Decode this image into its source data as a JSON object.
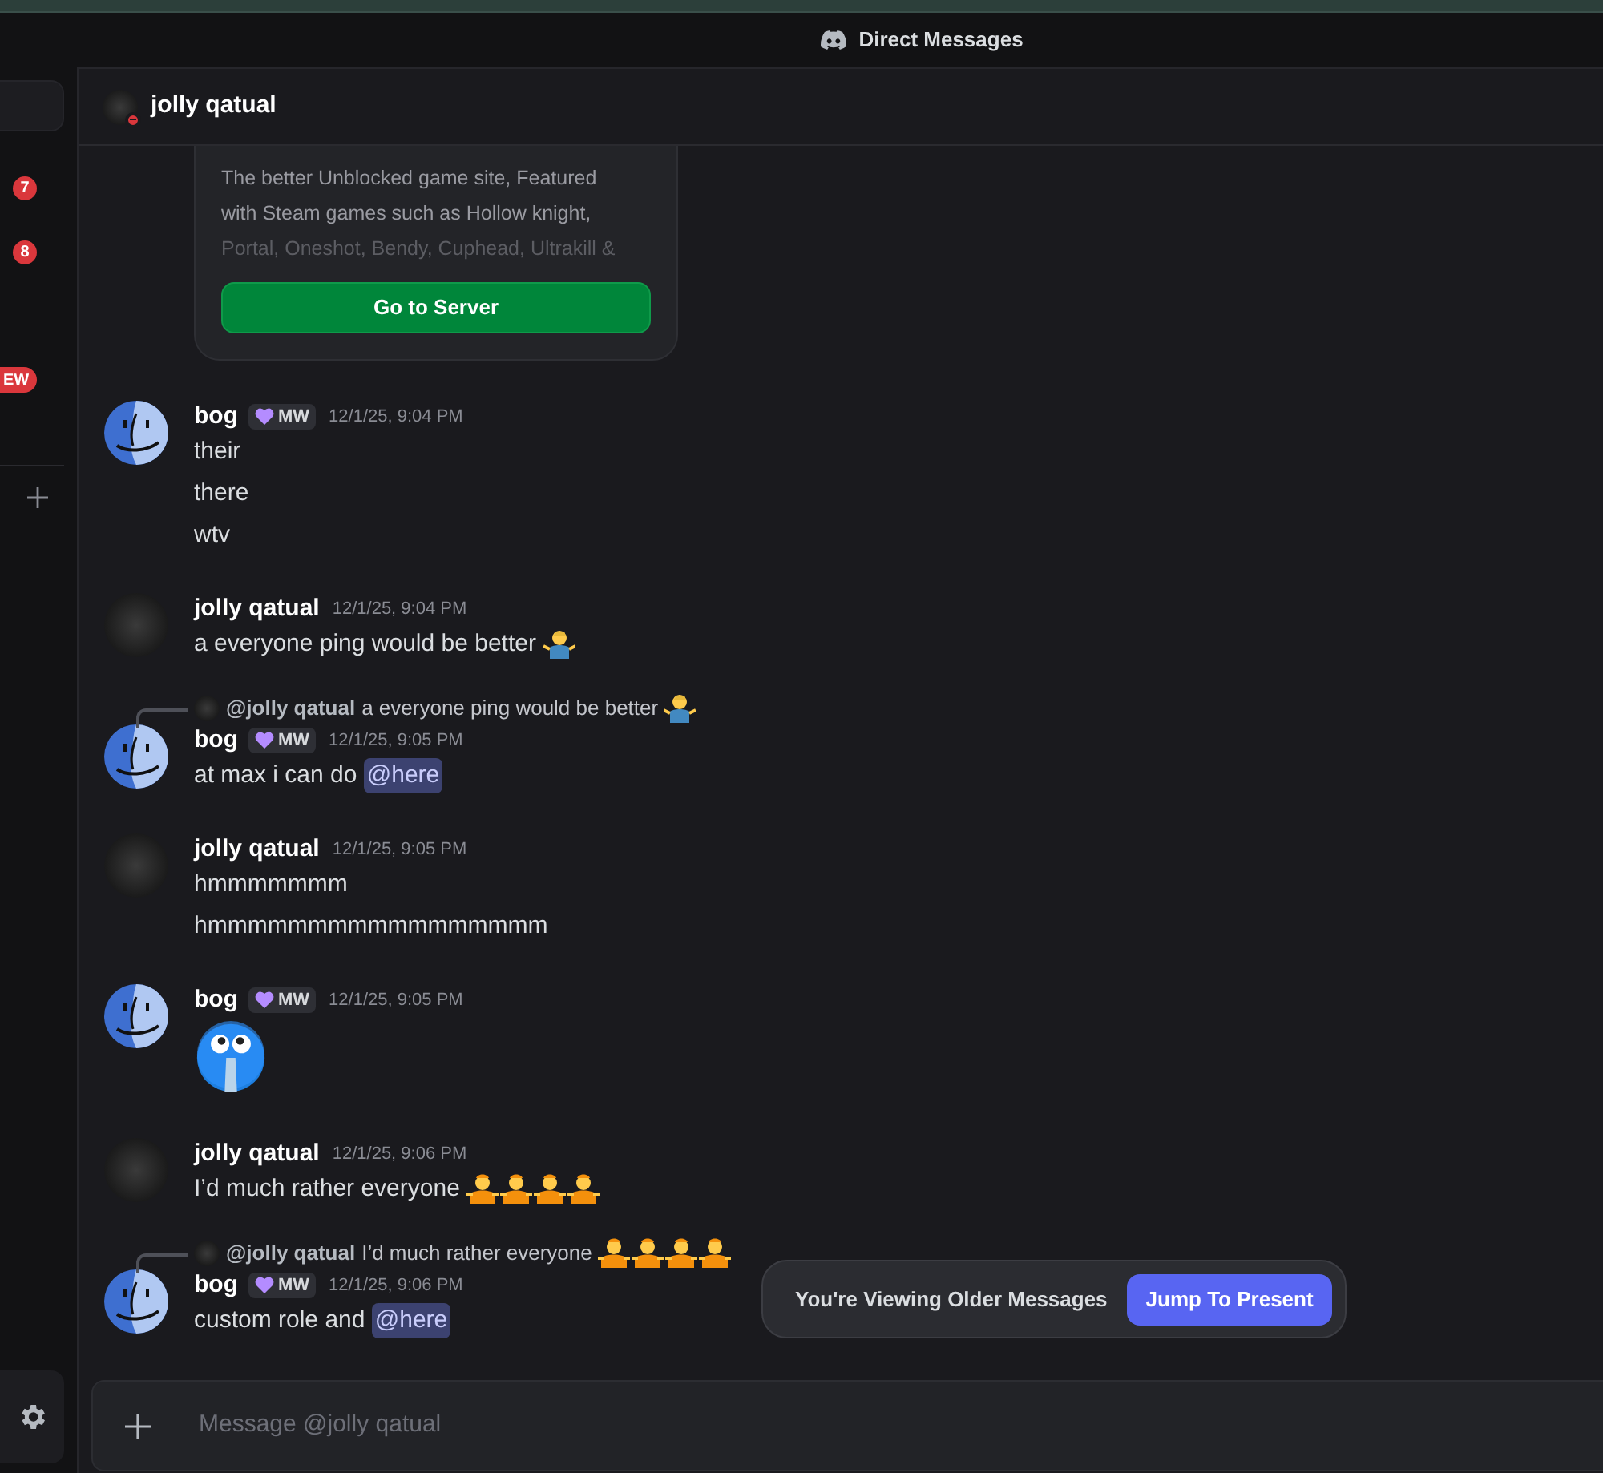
{
  "title_bar": {
    "title": "Direct Messages"
  },
  "sidebar": {
    "badges": [
      {
        "kind": "count",
        "text": "7"
      },
      {
        "kind": "count",
        "text": "8"
      },
      {
        "kind": "pill",
        "text": "EW"
      }
    ]
  },
  "channel_header": {
    "name": "jolly qatual",
    "status": {
      "kind": "dnd"
    }
  },
  "embed_card": {
    "description_lines": [
      "The better Unblocked game site, Featured",
      "with Steam games such as Hollow knight,",
      "Portal, Oneshot, Bendy, Cuphead, Ultrakill &"
    ],
    "button": "Go to Server"
  },
  "message_groups": [
    {
      "author": "bog",
      "avatar": {
        "kind": "finder"
      },
      "tag": "MW",
      "time": "12/1/25, 9:04 PM",
      "messages": [
        [
          {
            "kind": "text",
            "text": "their"
          }
        ],
        [
          {
            "kind": "text",
            "text": "there"
          }
        ],
        [
          {
            "kind": "text",
            "text": "wtv"
          }
        ]
      ]
    },
    {
      "author": "jolly qatual",
      "avatar": {
        "kind": "dark"
      },
      "time": "12/1/25, 9:04 PM",
      "messages": [
        [
          {
            "kind": "text",
            "text": "a everyone ping would be better "
          },
          {
            "kind": "shrug_emoji"
          }
        ]
      ]
    },
    {
      "reply": {
        "avatar": {
          "kind": "dark"
        },
        "author": "@jolly qatual",
        "content": [
          {
            "kind": "text",
            "text": "a everyone ping would be better "
          },
          {
            "kind": "shrug_emoji"
          }
        ]
      },
      "author": "bog",
      "avatar": {
        "kind": "finder"
      },
      "tag": "MW",
      "time": "12/1/25, 9:05 PM",
      "messages": [
        [
          {
            "kind": "text",
            "text": "at max i can do "
          },
          {
            "kind": "mention",
            "text": "@here"
          }
        ]
      ]
    },
    {
      "author": "jolly qatual",
      "avatar": {
        "kind": "dark"
      },
      "time": "12/1/25, 9:05 PM",
      "messages": [
        [
          {
            "kind": "text",
            "text": "hmmmmmmm"
          }
        ],
        [
          {
            "kind": "text",
            "text": "hmmmmmmmmmmmmmmmmm"
          }
        ]
      ]
    },
    {
      "author": "bog",
      "avatar": {
        "kind": "finder"
      },
      "tag": "MW",
      "time": "12/1/25, 9:05 PM",
      "messages": [
        [
          {
            "kind": "pleading_emoji"
          }
        ]
      ]
    },
    {
      "author": "jolly qatual",
      "avatar": {
        "kind": "dark"
      },
      "time": "12/1/25, 9:06 PM",
      "messages": [
        [
          {
            "kind": "text",
            "text": "I’d much rather everyone "
          },
          {
            "kind": "person_emoji"
          },
          {
            "kind": "person_emoji"
          },
          {
            "kind": "person_emoji"
          },
          {
            "kind": "person_emoji"
          }
        ]
      ]
    },
    {
      "reply": {
        "avatar": {
          "kind": "dark"
        },
        "author": "@jolly qatual",
        "content": [
          {
            "kind": "text",
            "text": "I’d much rather everyone "
          },
          {
            "kind": "person_emoji"
          },
          {
            "kind": "person_emoji"
          },
          {
            "kind": "person_emoji"
          },
          {
            "kind": "person_emoji"
          }
        ]
      },
      "author": "bog",
      "avatar": {
        "kind": "finder"
      },
      "tag": "MW",
      "time": "12/1/25, 9:06 PM",
      "messages": [
        [
          {
            "kind": "text",
            "text": "custom role and "
          },
          {
            "kind": "mention",
            "text": "@here"
          }
        ]
      ]
    }
  ],
  "older_messages_bar": {
    "text": "You're Viewing Older Messages",
    "button": "Jump To Present"
  },
  "composer": {
    "placeholder": "Message @jolly qatual"
  }
}
